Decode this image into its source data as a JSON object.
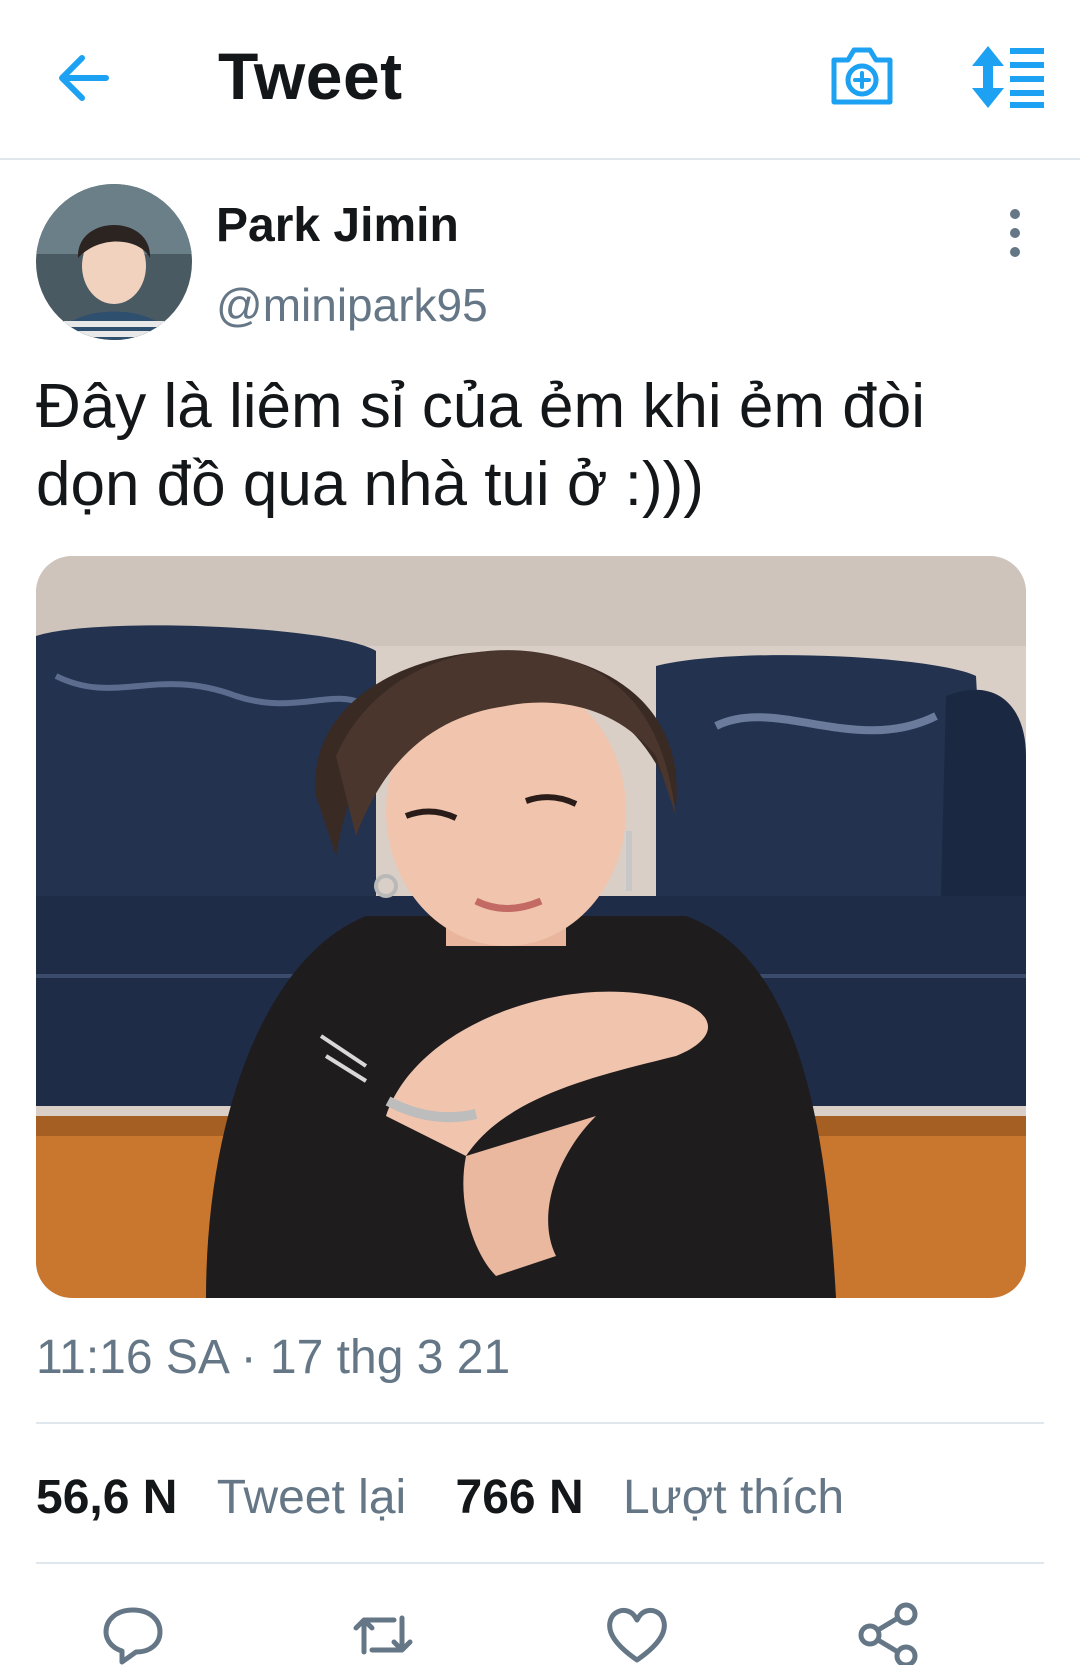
{
  "header": {
    "title": "Tweet",
    "icons": [
      "back-arrow-icon",
      "camera-add-icon",
      "sort-icon"
    ],
    "accent": "#1da1f2"
  },
  "tweet": {
    "author_name": "Park Jimin",
    "author_handle": "@minipark95",
    "text": "Đây là liêm sỉ của ẻm khi ẻm đòi dọn đồ qua nhà tui ở :)))",
    "timestamp": "11:16 SA · 17 thg 3 21"
  },
  "stats": {
    "retweets_count": "56,6 N",
    "retweets_label": "Tweet lại",
    "likes_count": "766 N",
    "likes_label": "Lượt thích"
  },
  "actions": [
    "reply-icon",
    "retweet-icon",
    "like-icon",
    "share-icon"
  ]
}
